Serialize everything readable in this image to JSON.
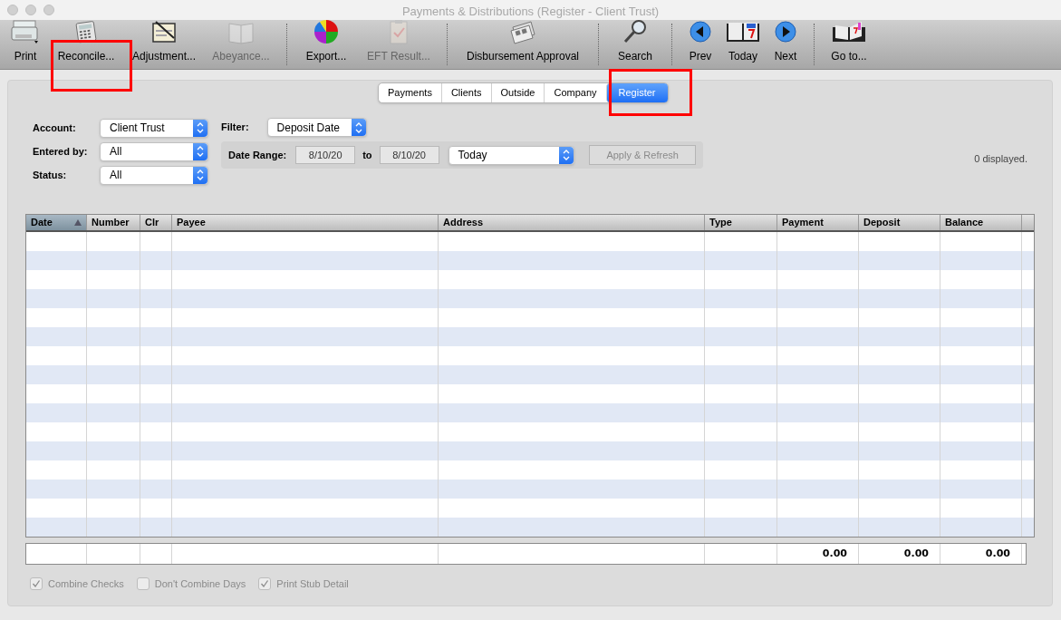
{
  "window": {
    "title": "Payments & Distributions (Register - Client Trust)"
  },
  "toolbar": [
    {
      "kind": "print",
      "label": "Print",
      "disabled": false,
      "separator_after": false
    },
    {
      "kind": "calculator",
      "label": "Reconcile...",
      "disabled": false,
      "separator_after": false
    },
    {
      "kind": "checkbook",
      "label": "Adjustment...",
      "disabled": false,
      "separator_after": false
    },
    {
      "kind": "book",
      "label": "Abeyance...",
      "disabled": true,
      "separator_after": true
    },
    {
      "kind": "pie",
      "label": "Export...",
      "disabled": false,
      "separator_after": false
    },
    {
      "kind": "clipboard",
      "label": "EFT Result...",
      "disabled": true,
      "separator_after": true
    },
    {
      "kind": "papers",
      "label": "Disbursement Approval",
      "disabled": false,
      "separator_after": true
    },
    {
      "kind": "search",
      "label": "Search",
      "disabled": false,
      "separator_after": true
    },
    {
      "kind": "prev",
      "label": "Prev",
      "disabled": false,
      "separator_after": false
    },
    {
      "kind": "calendar",
      "label": "Today",
      "disabled": false,
      "separator_after": false
    },
    {
      "kind": "next",
      "label": "Next",
      "disabled": false,
      "separator_after": true
    },
    {
      "kind": "goto",
      "label": "Go to...",
      "disabled": false,
      "separator_after": false
    }
  ],
  "tabs": [
    {
      "label": "Payments",
      "selected": false
    },
    {
      "label": "Clients",
      "selected": false
    },
    {
      "label": "Outside",
      "selected": false
    },
    {
      "label": "Company",
      "selected": false
    },
    {
      "label": "Register",
      "selected": true
    }
  ],
  "filters": {
    "account": {
      "label": "Account:",
      "value": "Client Trust"
    },
    "entered_by": {
      "label": "Entered by:",
      "value": "All"
    },
    "status": {
      "label": "Status:",
      "value": "All"
    },
    "filter": {
      "label": "Filter:",
      "value": "Deposit Date"
    },
    "date_range": {
      "label": "Date Range:",
      "from": "8/10/20",
      "to_label": "to",
      "to": "8/10/20",
      "preset": "Today"
    },
    "apply_button": {
      "label": "Apply & Refresh",
      "disabled": true
    },
    "count": "0 displayed."
  },
  "table": {
    "columns": [
      {
        "label": "Date",
        "sorted": true
      },
      {
        "label": "Number",
        "sorted": false
      },
      {
        "label": "Clr",
        "sorted": false
      },
      {
        "label": "Payee",
        "sorted": false
      },
      {
        "label": "Address",
        "sorted": false
      },
      {
        "label": "Type",
        "sorted": false
      },
      {
        "label": "Payment",
        "sorted": false
      },
      {
        "label": "Deposit",
        "sorted": false
      },
      {
        "label": "Balance",
        "sorted": false
      }
    ],
    "totals": [
      "0.00",
      "0.00",
      "0.00"
    ]
  },
  "options": [
    {
      "label": "Combine Checks",
      "checked": true,
      "disabled": true
    },
    {
      "label": "Don't Combine Days",
      "checked": false,
      "disabled": true
    },
    {
      "label": "Print Stub Detail",
      "checked": true,
      "disabled": true
    }
  ]
}
